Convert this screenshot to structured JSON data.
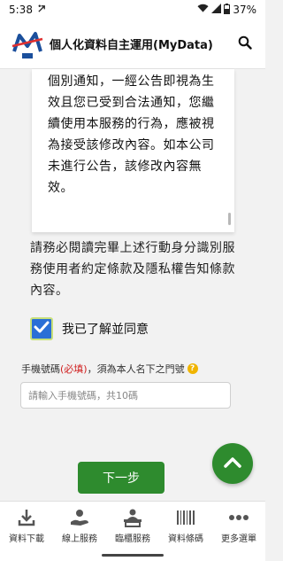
{
  "status_bar": {
    "time": "5:38",
    "battery": "37%"
  },
  "header": {
    "title": "個人化資料自主運用(MyData)"
  },
  "terms": {
    "text": "個別通知，一經公告即視為生效且您已受到合法通知，您繼續使用本服務的行為，應被視為接受該修改內容。如本公司未進行公告，該修改內容無效。"
  },
  "notice": {
    "text": "請務必閱讀完畢上述行動身分識別服務使用者約定條款及隱私權告知條款內容。"
  },
  "agreement": {
    "label": "我已了解並同意",
    "checked": true
  },
  "phone": {
    "label_prefix": "手機號碼",
    "required": "(必填)",
    "label_suffix": "，須為本人名下之門號",
    "help_glyph": "?",
    "placeholder": "請輸入手機號碼，共10碼"
  },
  "actions": {
    "next_label": "下一步"
  },
  "bottom_nav": {
    "items": [
      {
        "label": "資料下載",
        "icon": "download-icon"
      },
      {
        "label": "線上服務",
        "icon": "hand-service-icon"
      },
      {
        "label": "臨櫃服務",
        "icon": "counter-service-icon"
      },
      {
        "label": "資料條碼",
        "icon": "barcode-icon"
      },
      {
        "label": "更多選單",
        "icon": "more-icon"
      }
    ]
  },
  "colors": {
    "primary_green": "#2e8b2e",
    "checkbox_blue": "#2a6fd6",
    "required_red": "#d02020",
    "help_yellow": "#f0b400"
  }
}
